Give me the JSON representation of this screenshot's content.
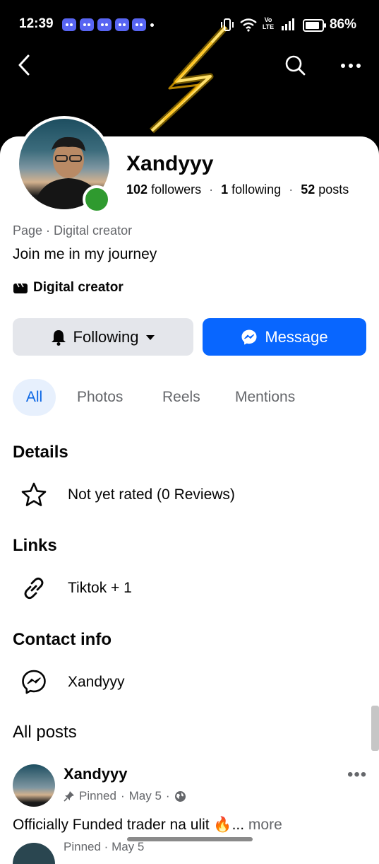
{
  "status_bar": {
    "time": "12:39",
    "battery": "86%",
    "network": "Vo LTE"
  },
  "profile": {
    "name": "Xandyyy",
    "followers_count": "102",
    "followers_label": "followers",
    "following_count": "1",
    "following_label": "following",
    "posts_count": "52",
    "posts_label": "posts",
    "page_type": "Page · Digital creator",
    "bio": "Join me in my journey",
    "category": "Digital creator"
  },
  "actions": {
    "following_label": "Following",
    "message_label": "Message"
  },
  "tabs": [
    "All",
    "Photos",
    "Reels",
    "Mentions"
  ],
  "details": {
    "heading": "Details",
    "rating_text": "Not yet rated (0 Reviews)"
  },
  "links": {
    "heading": "Links",
    "text": "Tiktok + 1"
  },
  "contact": {
    "heading": "Contact info",
    "messenger": "Xandyyy"
  },
  "posts": {
    "heading": "All posts",
    "items": [
      {
        "author": "Xandyyy",
        "pinned": "Pinned",
        "date": "May 5",
        "text": "Officially Funded trader na ulit 🔥...",
        "more": "more"
      },
      {
        "pinned": "Pinned",
        "date": "May 5"
      }
    ]
  },
  "colors": {
    "primary": "#0866ff",
    "online": "#2f9a2f",
    "tab_active_bg": "#e7f0fd",
    "secondary_button_bg": "#e4e6eb"
  }
}
